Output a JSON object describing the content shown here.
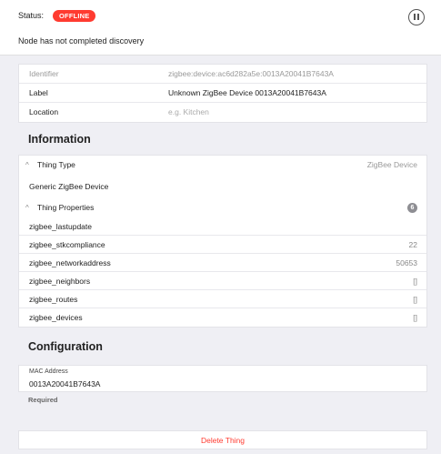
{
  "status": {
    "label": "Status:",
    "badge": "OFFLINE",
    "message": "Node has not completed discovery",
    "pause_icon": "pause-circle-icon"
  },
  "thing": {
    "identifier_label": "Identifier",
    "identifier_value": "zigbee:device:ac6d282a5e:0013A20041B7643A",
    "label_label": "Label",
    "label_value": "Unknown ZigBee Device 0013A20041B7643A",
    "location_label": "Location",
    "location_placeholder": "e.g. Kitchen"
  },
  "information": {
    "title": "Information",
    "thing_type_label": "Thing Type",
    "thing_type_value": "ZigBee Device",
    "thing_type_name": "Generic ZigBee Device",
    "properties_label": "Thing Properties",
    "properties_count": "6",
    "properties": [
      {
        "key": "zigbee_lastupdate",
        "value": ""
      },
      {
        "key": "zigbee_stkcompliance",
        "value": "22"
      },
      {
        "key": "zigbee_networkaddress",
        "value": "50653"
      },
      {
        "key": "zigbee_neighbors",
        "value": "[]"
      },
      {
        "key": "zigbee_routes",
        "value": "[]"
      },
      {
        "key": "zigbee_devices",
        "value": "[]"
      }
    ]
  },
  "configuration": {
    "title": "Configuration",
    "mac_label": "MAC Address",
    "mac_value": "0013A20041B7643A",
    "required": "Required"
  },
  "actions": {
    "delete_label": "Delete Thing"
  },
  "colors": {
    "offline": "#ff3b30",
    "delete": "#ff3b30",
    "background": "#efeff4"
  }
}
